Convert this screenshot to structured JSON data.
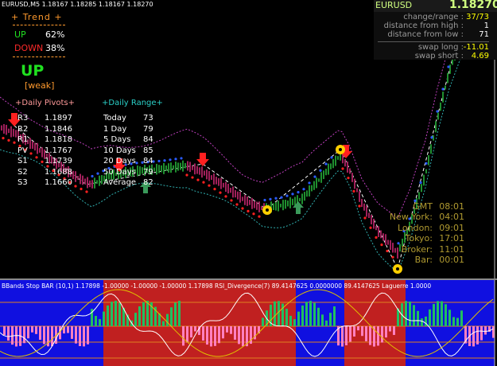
{
  "main_chart": {
    "title": "EURUSD,M5  1.18167 1.18285 1.18167 1.18270",
    "trend": {
      "heading": "+   Trend   +",
      "up_label": "UP",
      "up_value": "62%",
      "down_label": "DOWN",
      "down_value": "38%",
      "direction": "UP",
      "strength": "[weak]"
    },
    "daily_pivots": {
      "heading": "+Daily Pivots+",
      "rows": [
        {
          "label": "R3",
          "value": "1.1897"
        },
        {
          "label": "R2",
          "value": "1.1846"
        },
        {
          "label": "R1",
          "value": "1.1818"
        },
        {
          "label": "PV",
          "value": "1.1767"
        },
        {
          "label": "S1",
          "value": "1.1739"
        },
        {
          "label": "S2",
          "value": "1.1688"
        },
        {
          "label": "S3",
          "value": "1.1660"
        }
      ]
    },
    "daily_range": {
      "heading": "+Daily Range+",
      "rows": [
        {
          "label": "Today",
          "value": "73"
        },
        {
          "label": "1 Day",
          "value": "79"
        },
        {
          "label": "5 Days",
          "value": "84"
        },
        {
          "label": "10 Days",
          "value": "85"
        },
        {
          "label": "20 Days",
          "value": "84"
        },
        {
          "label": "50 Days",
          "value": "79"
        },
        {
          "label": "Average",
          "value": "82"
        }
      ]
    },
    "symbol_info": {
      "symbol": "EURUSD",
      "price": "1.18270",
      "rows": [
        {
          "label": "change/range :",
          "value": "37/73",
          "highlight": true
        },
        {
          "label": "distance from high :",
          "value": "1",
          "highlight": false
        },
        {
          "label": "distance from low :",
          "value": "71",
          "highlight": false
        }
      ],
      "swap_rows": [
        {
          "label": "swap long :",
          "value": "-11.01"
        },
        {
          "label": "swap short :",
          "value": "4.69"
        }
      ]
    },
    "sessions": [
      {
        "label": "GMT",
        "value": "08:01"
      },
      {
        "label": "New York:",
        "value": "04:01"
      },
      {
        "label": "London:",
        "value": "09:01"
      },
      {
        "label": "Tokyo:",
        "value": "17:01"
      },
      {
        "label": "Broker:",
        "value": "11:01"
      },
      {
        "label": "Bar:",
        "value": "00:01"
      }
    ],
    "colors": {
      "background": "#000000",
      "bull_candle": "#1f8f2f",
      "bear_candle": "#a0205a",
      "blue_dot": "#2a5cff",
      "red_dot": "#ff2020",
      "signal_yellow": "#ffd000"
    },
    "icons": [
      "red-down-arrow-icon",
      "green-up-arrow-icon",
      "yellow-circle-signal-icon"
    ]
  },
  "sub_chart": {
    "title": "BBands Stop BAR (10,1) 1.17898 -1.00000 -1.00000 -1.00000 1.17898  RSI_Divergence(7) 89.4147625 0.0000000 89.4147625  Laguerre 1.0000",
    "colors": {
      "up_zone": "#1010e0",
      "down_zone": "#c02020",
      "up_hist": "#20c060",
      "down_hist": "#ff80c0",
      "rsi_line": "#ffffff",
      "laguerre_line": "#e0c000",
      "level_line": "#e08020"
    }
  }
}
